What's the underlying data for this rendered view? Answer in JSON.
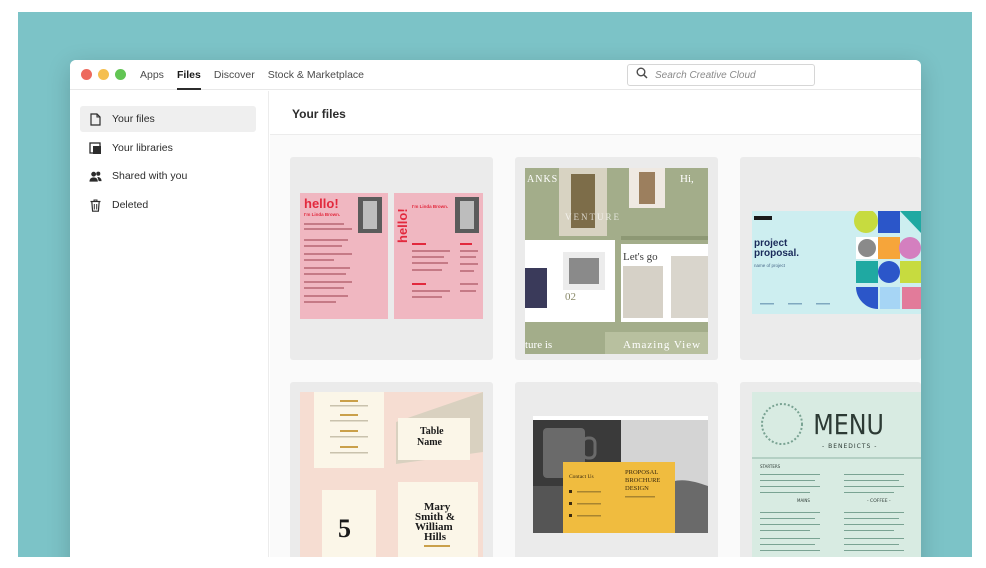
{
  "window": {
    "traffic_lights": [
      "#ed6a5e",
      "#f5bf4f",
      "#62c554"
    ]
  },
  "nav": {
    "items": [
      {
        "label": "Apps",
        "active": false
      },
      {
        "label": "Files",
        "active": true
      },
      {
        "label": "Discover",
        "active": false
      },
      {
        "label": "Stock & Marketplace",
        "active": false
      }
    ]
  },
  "search": {
    "placeholder": "Search Creative Cloud",
    "icon": "search-icon"
  },
  "sidebar": {
    "items": [
      {
        "label": "Your files",
        "icon": "file-icon",
        "active": true
      },
      {
        "label": "Your libraries",
        "icon": "library-icon",
        "active": false
      },
      {
        "label": "Shared with you",
        "icon": "people-icon",
        "active": false
      },
      {
        "label": "Deleted",
        "icon": "trash-icon",
        "active": false
      }
    ]
  },
  "main": {
    "title": "Your files",
    "thumbnails": {
      "resume": {
        "hello1": "hello!",
        "sub1": "I'm Linda Brown.",
        "hello2": "hello!",
        "sub2": "I'm Linda Brown."
      },
      "magazine": {
        "anks": "ANKS",
        "hi": "Hi,",
        "lets_go": "Let's go",
        "num": "02",
        "ture": "ture is",
        "amazing": "Amazing  View"
      },
      "proposal": {
        "line1": "project",
        "line2": "proposal.",
        "sub": "name of project"
      },
      "wedding": {
        "table_name_1": "Table",
        "table_name_2": "Name",
        "table_number": "5",
        "names_1": "Mary",
        "names_2": "Smith &",
        "names_3": "William",
        "names_4": "Hills"
      },
      "brochure": {
        "contact": "Contact Us",
        "title_1": "PROPOSAL",
        "title_2": "BROCHURE",
        "title_3": "DESIGN"
      },
      "menu": {
        "title": "MENU",
        "subtitle": "- BENEDICTS -",
        "starters": "STARTERS",
        "section": "- COFFEE -",
        "mains": "MAINS"
      }
    }
  },
  "colors": {
    "background": "#7cc3c7",
    "resume_pink": "#f0b7c1",
    "resume_red": "#e2293d",
    "magazine_green": "#a3ad8a",
    "proposal_cyan": "#cdeef0",
    "wedding_peach": "#f6ddd2",
    "brochure_yellow": "#f0bc3f",
    "menu_mint": "#d8ebe2"
  }
}
